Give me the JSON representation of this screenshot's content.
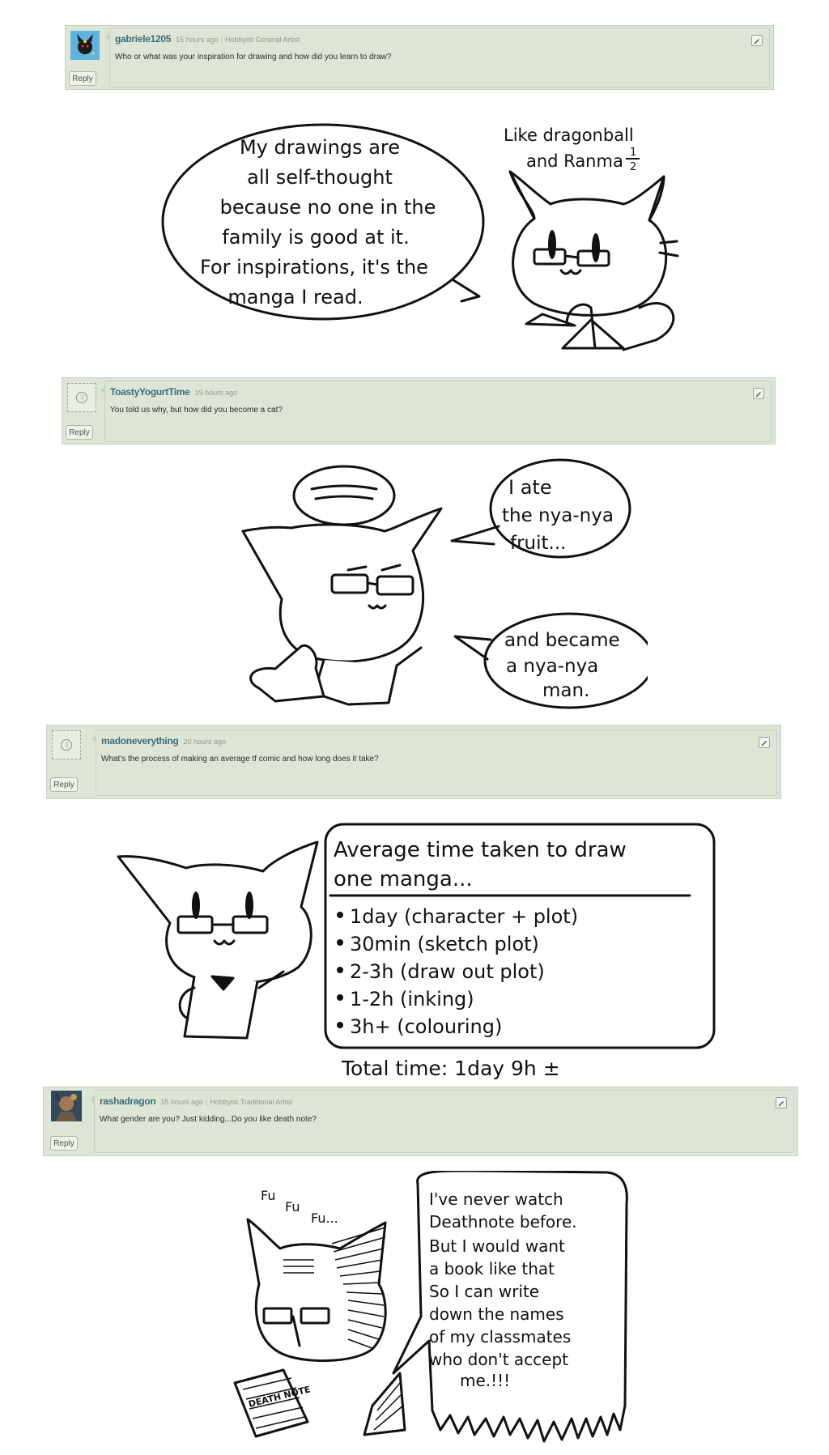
{
  "comments": [
    {
      "username": "gabriele1205",
      "time": "15 hours ago",
      "role": "Hobbyist General Artist",
      "text": "Who or what was your inspiration for drawing and how did you learn to draw?",
      "reply_label": "Reply"
    },
    {
      "username": "ToastyYogurtTime",
      "time": "19 hours ago",
      "role": "",
      "text": "You told us why, but how did you become a cat?",
      "reply_label": "Reply"
    },
    {
      "username": "madoneverything",
      "time": "20 hours ago",
      "role": "",
      "text": "What's the process of making an average tf comic and how long does it take?",
      "reply_label": "Reply"
    },
    {
      "username": "rashadragon",
      "time": "15 hours ago",
      "role": "Hobbyist Traditional Artist",
      "text": "What gender are you? Just kidding...Do you like death note?",
      "reply_label": "Reply"
    }
  ],
  "panels": {
    "p1": {
      "bubble_lines": [
        "My drawings are",
        "all self-thought",
        "because no one in the",
        "family is good at it.",
        "For inspirations, it's the",
        "manga I read."
      ],
      "side_lines": [
        "Like dragonball",
        "and Ranma",
        "1",
        "2"
      ]
    },
    "p2": {
      "bubble1_lines": [
        "I ate",
        "the nya-nya",
        "fruit..."
      ],
      "bubble2_lines": [
        "and became",
        "a nya-nya",
        "man."
      ]
    },
    "p3": {
      "box_title_lines": [
        "Average time taken to draw",
        "one manga..."
      ],
      "items": [
        "1day (character + plot)",
        "30min (sketch plot)",
        "2-3h (draw out plot)",
        "1-2h (inking)",
        "3h+ (colouring)"
      ],
      "total": "Total time: 1day 9h ±"
    },
    "p4": {
      "sfx": [
        "Fu",
        "Fu",
        "Fu..."
      ],
      "bubble_lines": [
        "I've never watch",
        "Deathnote before.",
        "But I would want",
        "a book like that",
        "So I can write",
        "down the names",
        "of my classmates",
        "who don't accept",
        "me.!!!"
      ],
      "book_label": "DEATH NOTE"
    }
  },
  "colors": {
    "comment_bg": "#dde6d6",
    "username": "#3d6b78"
  }
}
